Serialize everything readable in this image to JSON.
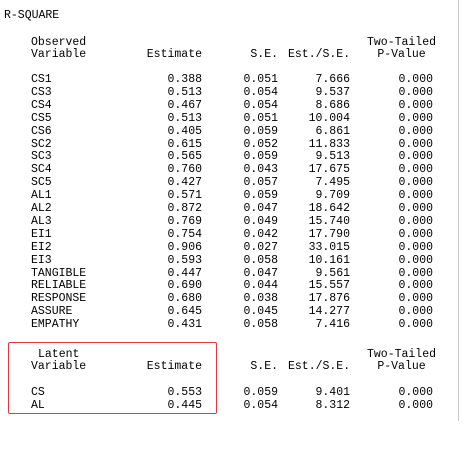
{
  "title": "R-SQUARE",
  "observed": {
    "header": {
      "var_line1": "Observed",
      "var_line2": "Variable",
      "estimate": "Estimate",
      "se": "S.E.",
      "ratio": "Est./S.E.",
      "p_line1": "Two-Tailed",
      "p_line2": "P-Value"
    },
    "rows": [
      {
        "var": "CS1",
        "est": "0.388",
        "se": "0.051",
        "ratio": "7.666",
        "p": "0.000"
      },
      {
        "var": "CS3",
        "est": "0.513",
        "se": "0.054",
        "ratio": "9.537",
        "p": "0.000"
      },
      {
        "var": "CS4",
        "est": "0.467",
        "se": "0.054",
        "ratio": "8.686",
        "p": "0.000"
      },
      {
        "var": "CS5",
        "est": "0.513",
        "se": "0.051",
        "ratio": "10.004",
        "p": "0.000"
      },
      {
        "var": "CS6",
        "est": "0.405",
        "se": "0.059",
        "ratio": "6.861",
        "p": "0.000"
      },
      {
        "var": "SC2",
        "est": "0.615",
        "se": "0.052",
        "ratio": "11.833",
        "p": "0.000"
      },
      {
        "var": "SC3",
        "est": "0.565",
        "se": "0.059",
        "ratio": "9.513",
        "p": "0.000"
      },
      {
        "var": "SC4",
        "est": "0.760",
        "se": "0.043",
        "ratio": "17.675",
        "p": "0.000"
      },
      {
        "var": "SC5",
        "est": "0.427",
        "se": "0.057",
        "ratio": "7.495",
        "p": "0.000"
      },
      {
        "var": "AL1",
        "est": "0.571",
        "se": "0.059",
        "ratio": "9.709",
        "p": "0.000"
      },
      {
        "var": "AL2",
        "est": "0.872",
        "se": "0.047",
        "ratio": "18.642",
        "p": "0.000"
      },
      {
        "var": "AL3",
        "est": "0.769",
        "se": "0.049",
        "ratio": "15.740",
        "p": "0.000"
      },
      {
        "var": "EI1",
        "est": "0.754",
        "se": "0.042",
        "ratio": "17.790",
        "p": "0.000"
      },
      {
        "var": "EI2",
        "est": "0.906",
        "se": "0.027",
        "ratio": "33.015",
        "p": "0.000"
      },
      {
        "var": "EI3",
        "est": "0.593",
        "se": "0.058",
        "ratio": "10.161",
        "p": "0.000"
      },
      {
        "var": "TANGIBLE",
        "est": "0.447",
        "se": "0.047",
        "ratio": "9.561",
        "p": "0.000"
      },
      {
        "var": "RELIABLE",
        "est": "0.690",
        "se": "0.044",
        "ratio": "15.557",
        "p": "0.000"
      },
      {
        "var": "RESPONSE",
        "est": "0.680",
        "se": "0.038",
        "ratio": "17.876",
        "p": "0.000"
      },
      {
        "var": "ASSURE",
        "est": "0.645",
        "se": "0.045",
        "ratio": "14.277",
        "p": "0.000"
      },
      {
        "var": "EMPATHY",
        "est": "0.431",
        "se": "0.058",
        "ratio": "7.416",
        "p": "0.000"
      }
    ]
  },
  "latent": {
    "header": {
      "var_line1": "Latent",
      "var_line2": "Variable",
      "estimate": "Estimate",
      "se": "S.E.",
      "ratio": "Est./S.E.",
      "p_line1": "Two-Tailed",
      "p_line2": "P-Value"
    },
    "rows": [
      {
        "var": "CS",
        "est": "0.553",
        "se": "0.059",
        "ratio": "9.401",
        "p": "0.000"
      },
      {
        "var": "AL",
        "est": "0.445",
        "se": "0.054",
        "ratio": "8.312",
        "p": "0.000"
      }
    ]
  },
  "highlight_color": "#e0393e"
}
